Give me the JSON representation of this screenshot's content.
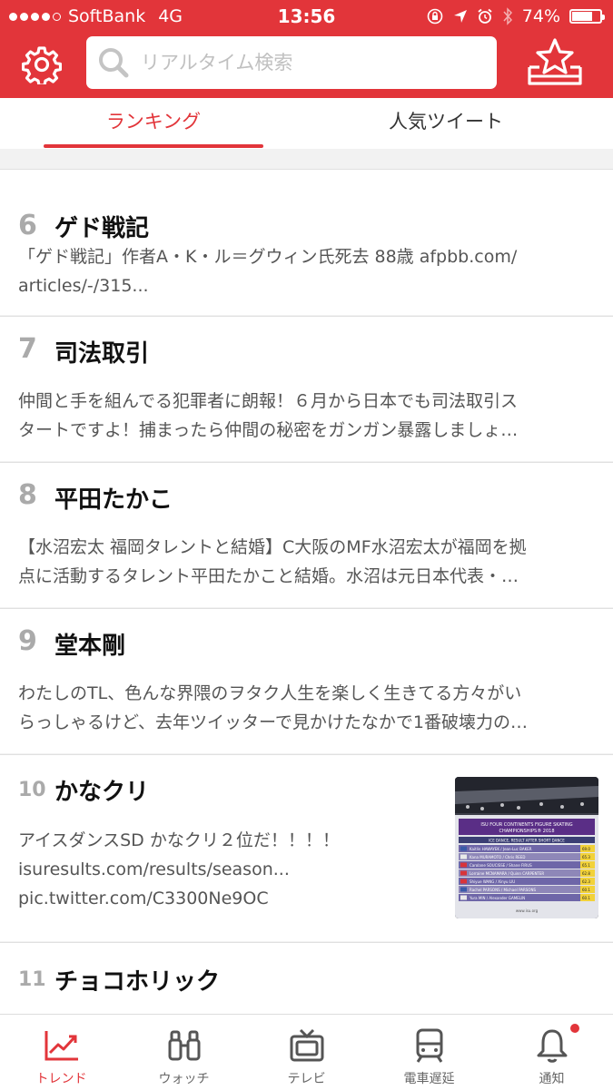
{
  "status_bar": {
    "carrier": "SoftBank",
    "network": "4G",
    "time": "13:56",
    "battery": "74%",
    "battery_level": 0.74,
    "signal_bars": 4
  },
  "header": {
    "search_placeholder": "リアルタイム検索",
    "accent_color": "#e2353a"
  },
  "tabs": [
    {
      "label": "ランキング",
      "active": true
    },
    {
      "label": "人気ツイート",
      "active": false
    }
  ],
  "ranking": [
    {
      "rank": "6",
      "title": "ゲド戦記",
      "snippet": [
        "「ゲド戦記」作者A・K・ル＝グウィン氏死去 88歳 afpbb.com/",
        "articles/-/315..."
      ]
    },
    {
      "rank": "7",
      "title": "司法取引",
      "snippet": [
        "仲間と手を組んでる犯罪者に朗報！６月から日本でも司法取引ス",
        "タートですよ！捕まったら仲間の秘密をガンガン暴露しましょ…"
      ]
    },
    {
      "rank": "8",
      "title": "平田たかこ",
      "snippet": [
        "【水沼宏太 福岡タレントと結婚】C大阪のMF水沼宏太が福岡を拠",
        "点に活動するタレント平田たかこと結婚。水沼は元日本代表・…"
      ]
    },
    {
      "rank": "9",
      "title": "堂本剛",
      "snippet": [
        "わたしのTL、色んな界隈のヲタク人生を楽しく生きてる方々がい",
        "らっしゃるけど、去年ツイッターで見かけたなかで1番破壊力の…"
      ]
    },
    {
      "rank": "10",
      "title": "かなクリ",
      "snippet": [
        "アイスダンスSD かなクリ２位だ！！！！",
        "isuresults.com/results/season...",
        "pic.twitter.com/C3300Ne9OC"
      ],
      "thumbnail": {
        "banner_line1": "ISU FOUR CONTINENTS FIGURE SKATING",
        "banner_line2": "CHAMPIONSHIPS® 2018",
        "subtitle": "ICE DANCE, RESULT AFTER SHORT DANCE",
        "rows": [
          {
            "name": "Kaitlin HAWAYEK / Jean-Luc BAKER",
            "score": "69.0"
          },
          {
            "name": "Kana MURAMOTO / Chris REED",
            "score": "65.3"
          },
          {
            "name": "Carolane SOUCISSE / Shane FIRUS",
            "score": "65.1"
          },
          {
            "name": "Lorraine MCNAMARA / Quinn CARPENTER",
            "score": "62.8"
          },
          {
            "name": "Shiyue WANG / Xinyu LIU",
            "score": "62.3"
          },
          {
            "name": "Rachel PARSONS / Michael PARSONS",
            "score": "60.1"
          },
          {
            "name": "Yura MIN / Alexander GAMELIN",
            "score": "60.1"
          }
        ],
        "footer": "www.isu.org"
      }
    },
    {
      "rank": "11",
      "title": "チョコホリック",
      "snippet": []
    }
  ],
  "bottom_nav": [
    {
      "label": "トレンド",
      "icon": "trend-chart-icon",
      "active": true
    },
    {
      "label": "ウォッチ",
      "icon": "binoculars-icon",
      "active": false
    },
    {
      "label": "テレビ",
      "icon": "tv-icon",
      "active": false
    },
    {
      "label": "電車遅延",
      "icon": "train-icon",
      "active": false
    },
    {
      "label": "通知",
      "icon": "bell-icon",
      "active": false,
      "badge": true
    }
  ]
}
